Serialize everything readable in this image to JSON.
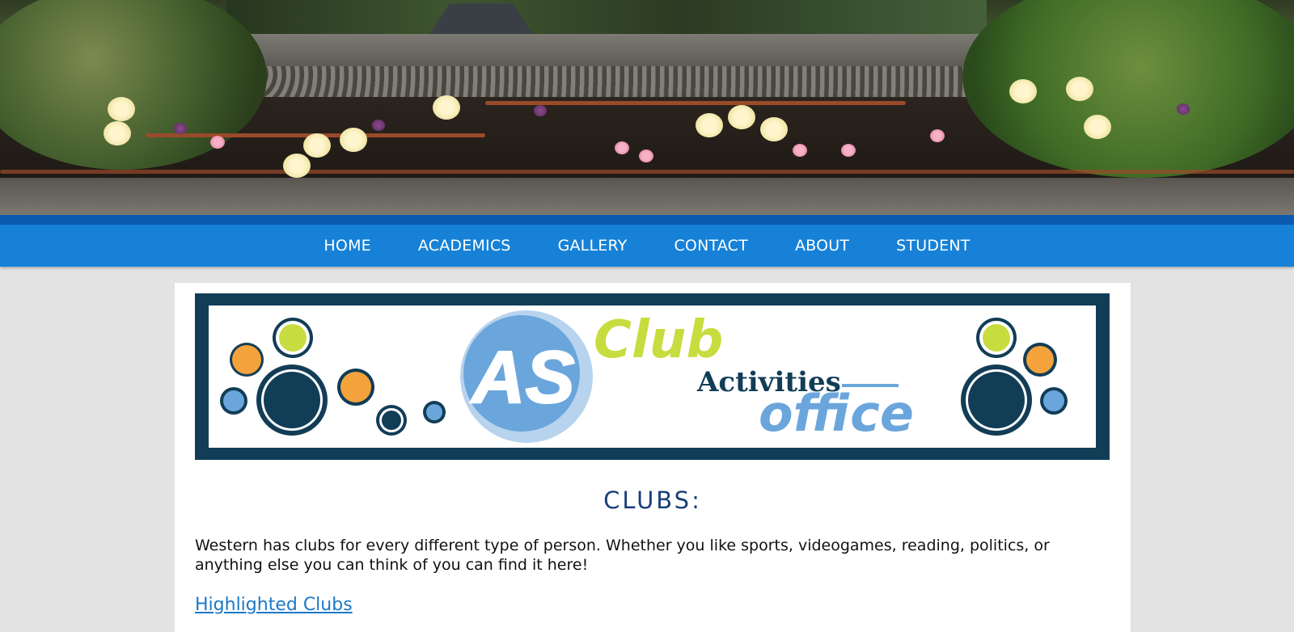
{
  "nav": {
    "items": [
      "HOME",
      "ACADEMICS",
      "GALLERY",
      "CONTACT",
      "ABOUT",
      "STUDENT"
    ]
  },
  "banner": {
    "logo_letters": "AS",
    "word_club": "Club",
    "word_activities": "Activities",
    "word_office": "office"
  },
  "main": {
    "heading": "CLUBS:",
    "intro": "Western has clubs for every different type of person. Whether you like sports, videogames, reading, politics, or anything else you can think of you can find it here!",
    "highlight_link": "Highlighted Clubs"
  },
  "colors": {
    "nav_bar": "#1681d6",
    "nav_bar_top": "#0b5bb0",
    "banner_frame": "#123d56",
    "heading": "#1a3f7a",
    "link": "#1c78c7",
    "circle_lime": "#c7dc3e",
    "circle_orange": "#f4a23c",
    "circle_blue": "#6aa6dc",
    "circle_navy": "#123d56"
  }
}
